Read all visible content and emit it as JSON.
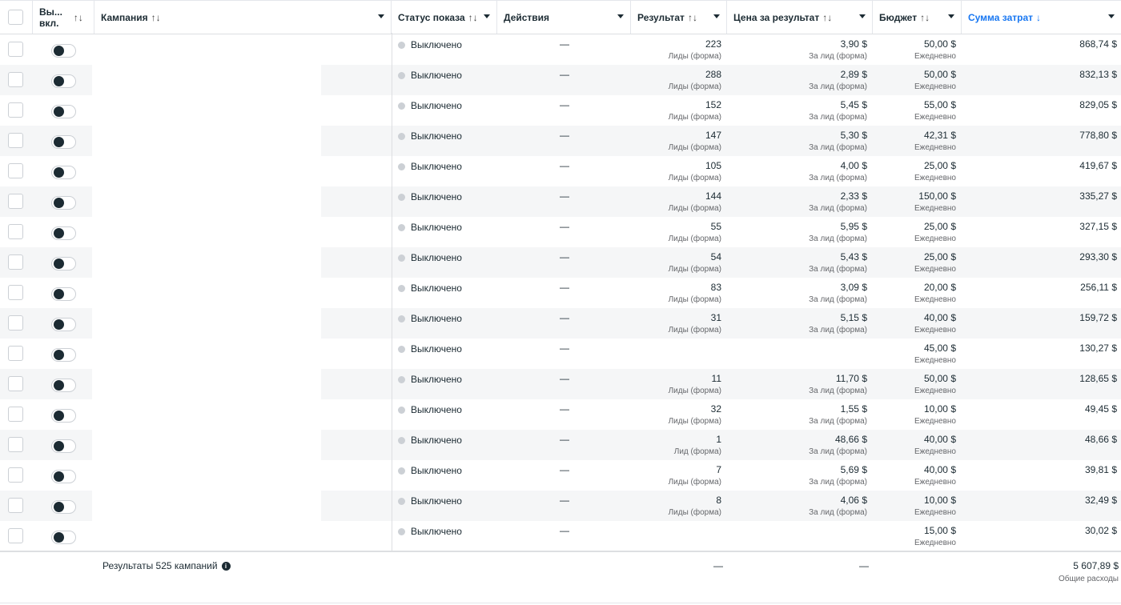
{
  "header": {
    "onoff_line1": "Вы...",
    "onoff_line2": "вкл.",
    "campaign": "Кампания",
    "status": "Статус показа",
    "actions": "Действия",
    "result": "Результат",
    "cost_per_result": "Цена за результат",
    "budget": "Бюджет",
    "amount_spent": "Сумма затрат",
    "sort_glyph": "↑↓",
    "sort_desc_glyph": "↓"
  },
  "rows": [
    {
      "status": "Выключено",
      "actions": "—",
      "result": "223",
      "result_type": "Лиды (форма)",
      "cpr": "3,90 $",
      "cpr_type": "За лид (форма)",
      "budget": "50,00 $",
      "budget_type": "Ежедневно",
      "spent": "868,74 $"
    },
    {
      "status": "Выключено",
      "actions": "—",
      "result": "288",
      "result_type": "Лиды (форма)",
      "cpr": "2,89 $",
      "cpr_type": "За лид (форма)",
      "budget": "50,00 $",
      "budget_type": "Ежедневно",
      "spent": "832,13 $"
    },
    {
      "status": "Выключено",
      "actions": "—",
      "result": "152",
      "result_type": "Лиды (форма)",
      "cpr": "5,45 $",
      "cpr_type": "За лид (форма)",
      "budget": "55,00 $",
      "budget_type": "Ежедневно",
      "spent": "829,05 $"
    },
    {
      "status": "Выключено",
      "actions": "—",
      "result": "147",
      "result_type": "Лиды (форма)",
      "cpr": "5,30 $",
      "cpr_type": "За лид (форма)",
      "budget": "42,31 $",
      "budget_type": "Ежедневно",
      "spent": "778,80 $"
    },
    {
      "status": "Выключено",
      "actions": "—",
      "result": "105",
      "result_type": "Лиды (форма)",
      "cpr": "4,00 $",
      "cpr_type": "За лид (форма)",
      "budget": "25,00 $",
      "budget_type": "Ежедневно",
      "spent": "419,67 $"
    },
    {
      "status": "Выключено",
      "actions": "—",
      "result": "144",
      "result_type": "Лиды (форма)",
      "cpr": "2,33 $",
      "cpr_type": "За лид (форма)",
      "budget": "150,00 $",
      "budget_type": "Ежедневно",
      "spent": "335,27 $"
    },
    {
      "status": "Выключено",
      "actions": "—",
      "result": "55",
      "result_type": "Лиды (форма)",
      "cpr": "5,95 $",
      "cpr_type": "За лид (форма)",
      "budget": "25,00 $",
      "budget_type": "Ежедневно",
      "spent": "327,15 $"
    },
    {
      "status": "Выключено",
      "actions": "—",
      "result": "54",
      "result_type": "Лиды (форма)",
      "cpr": "5,43 $",
      "cpr_type": "За лид (форма)",
      "budget": "25,00 $",
      "budget_type": "Ежедневно",
      "spent": "293,30 $"
    },
    {
      "status": "Выключено",
      "actions": "—",
      "result": "83",
      "result_type": "Лиды (форма)",
      "cpr": "3,09 $",
      "cpr_type": "За лид (форма)",
      "budget": "20,00 $",
      "budget_type": "Ежедневно",
      "spent": "256,11 $"
    },
    {
      "status": "Выключено",
      "actions": "—",
      "result": "31",
      "result_type": "Лиды (форма)",
      "cpr": "5,15 $",
      "cpr_type": "За лид (форма)",
      "budget": "40,00 $",
      "budget_type": "Ежедневно",
      "spent": "159,72 $"
    },
    {
      "status": "Выключено",
      "actions": "—",
      "result": "",
      "result_type": "",
      "cpr": "",
      "cpr_type": "",
      "budget": "45,00 $",
      "budget_type": "Ежедневно",
      "spent": "130,27 $"
    },
    {
      "status": "Выключено",
      "actions": "—",
      "result": "11",
      "result_type": "Лиды (форма)",
      "cpr": "11,70 $",
      "cpr_type": "За лид (форма)",
      "budget": "50,00 $",
      "budget_type": "Ежедневно",
      "spent": "128,65 $"
    },
    {
      "status": "Выключено",
      "actions": "—",
      "result": "32",
      "result_type": "Лиды (форма)",
      "cpr": "1,55 $",
      "cpr_type": "За лид (форма)",
      "budget": "10,00 $",
      "budget_type": "Ежедневно",
      "spent": "49,45 $"
    },
    {
      "status": "Выключено",
      "actions": "—",
      "result": "1",
      "result_type": "Лид (форма)",
      "cpr": "48,66 $",
      "cpr_type": "За лид (форма)",
      "budget": "40,00 $",
      "budget_type": "Ежедневно",
      "spent": "48,66 $"
    },
    {
      "status": "Выключено",
      "actions": "—",
      "result": "7",
      "result_type": "Лиды (форма)",
      "cpr": "5,69 $",
      "cpr_type": "За лид (форма)",
      "budget": "40,00 $",
      "budget_type": "Ежедневно",
      "spent": "39,81 $"
    },
    {
      "status": "Выключено",
      "actions": "—",
      "result": "8",
      "result_type": "Лиды (форма)",
      "cpr": "4,06 $",
      "cpr_type": "За лид (форма)",
      "budget": "10,00 $",
      "budget_type": "Ежедневно",
      "spent": "32,49 $"
    },
    {
      "status": "Выключено",
      "actions": "—",
      "result": "",
      "result_type": "",
      "cpr": "",
      "cpr_type": "",
      "budget": "15,00 $",
      "budget_type": "Ежедневно",
      "spent": "30,02 $"
    }
  ],
  "footer": {
    "label": "Результаты 525 кампаний",
    "result_dash": "—",
    "cpr_dash": "—",
    "total_spent": "5 607,89 $",
    "total_label": "Общие расходы"
  },
  "colors": {
    "accent": "#1877f2",
    "status_off_dot": "#ccd0d5",
    "toggle_knob": "#1c2b33",
    "row_stripe": "#f5f6f7"
  }
}
